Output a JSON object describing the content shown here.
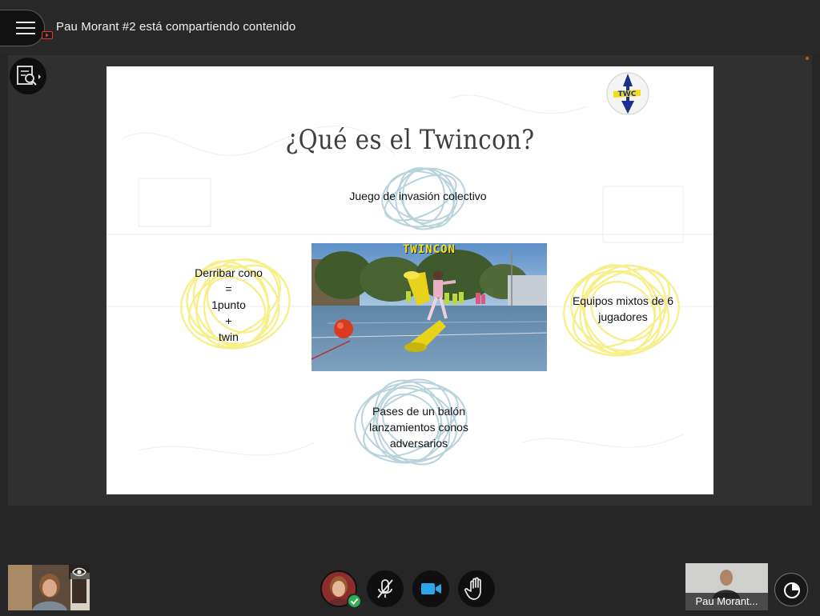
{
  "header": {
    "share_title": "Pau Morant #2 está compartiendo contenido"
  },
  "slide": {
    "title": "¿Qué es el Twincon?",
    "logo_text": "TWC",
    "photo_label": "TWINCON",
    "text_top": "Juego de invasión colectivo",
    "text_left_lines": [
      "Derribar cono",
      "=",
      "1punto",
      "+",
      "twin"
    ],
    "text_right_lines": [
      "Equipos mixtos de 6",
      "jugadores"
    ],
    "text_bottom_lines": [
      "Pases de un balón",
      "lanzamientos  conos",
      "adversarios"
    ]
  },
  "colors": {
    "yellow_scribble": "#f7ef8c",
    "blue_scribble": "#b8d3dc",
    "accent_green": "#2eae4f",
    "recording_red": "#e0373a"
  },
  "controls": {
    "icons": [
      "menu-icon",
      "screen-share-icon",
      "presentation-settings-icon",
      "eye-icon",
      "mic-muted-icon",
      "camera-icon",
      "raise-hand-icon",
      "layout-icon",
      "check-icon"
    ]
  },
  "participants": {
    "remote_name": "Pau Morant..."
  }
}
